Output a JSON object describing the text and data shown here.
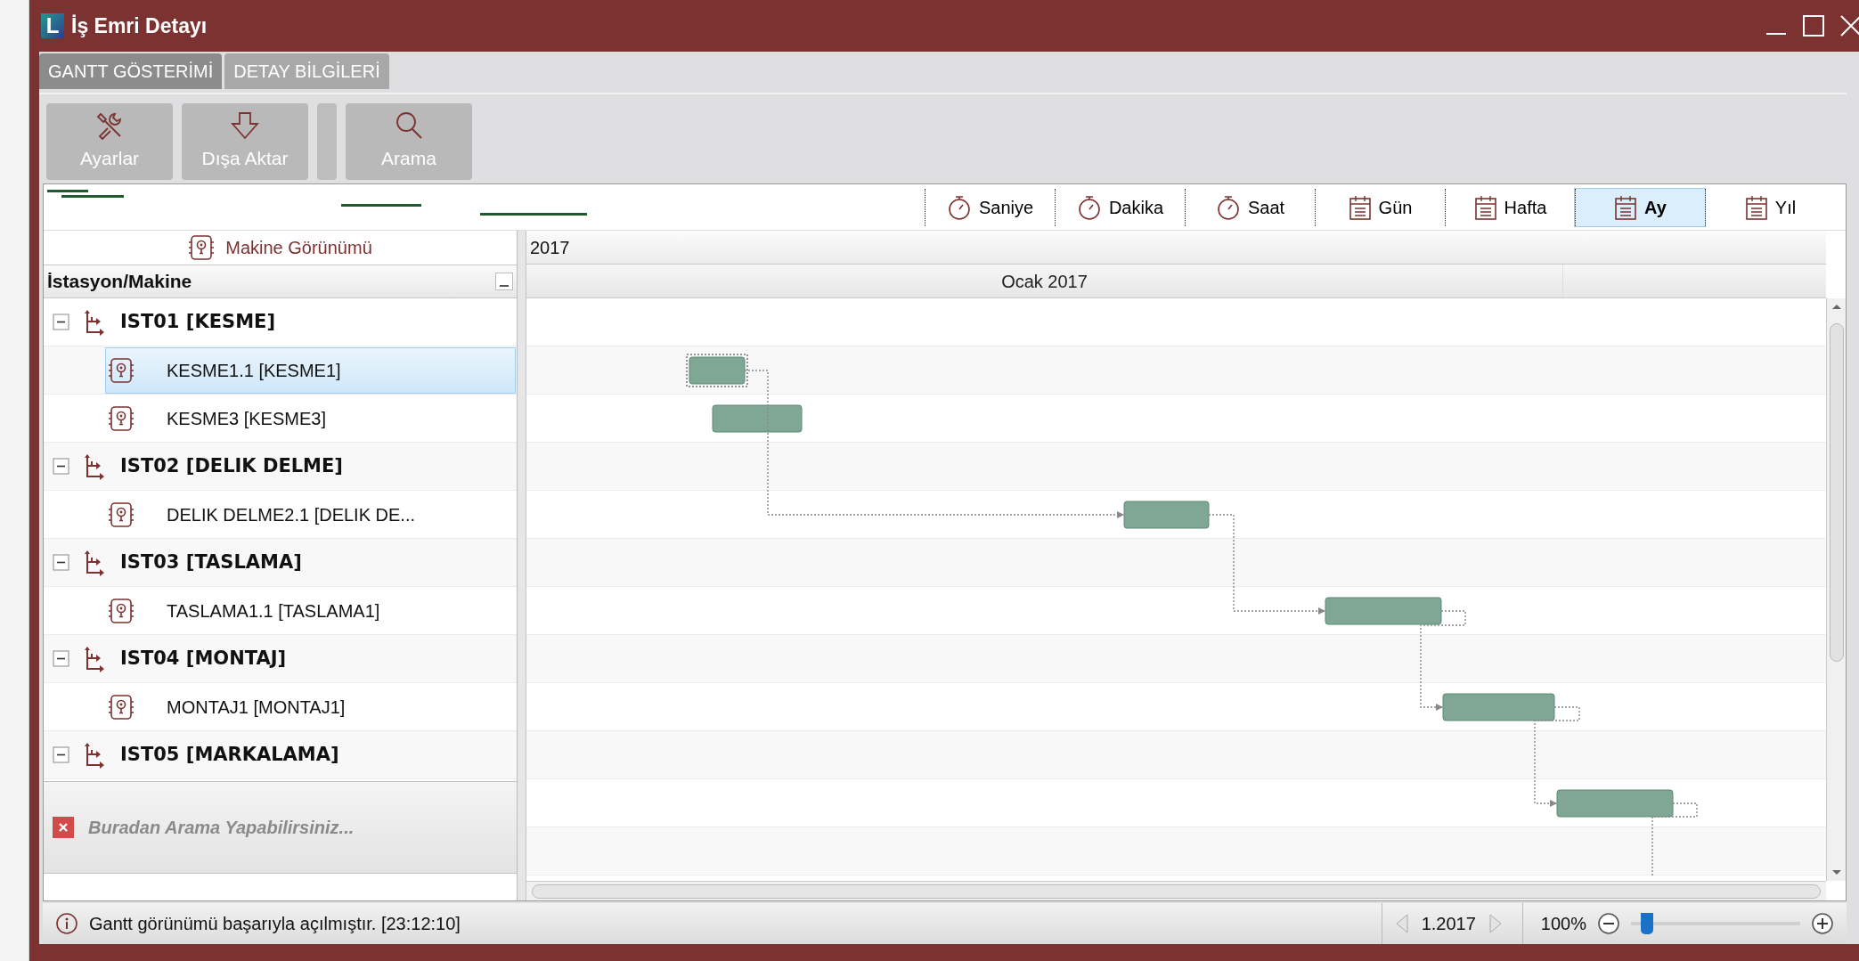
{
  "window": {
    "logo": "L",
    "title": "İş Emri Detayı"
  },
  "tabs": [
    {
      "label": "GANTT GÖSTERİMİ",
      "selected": true
    },
    {
      "label": "DETAY BİLGİLERİ",
      "selected": false
    }
  ],
  "toolbar": [
    {
      "kind": "tools",
      "label": "Ayarlar"
    },
    {
      "kind": "export",
      "label": "Dışa Aktar"
    },
    {
      "kind": "separator"
    },
    {
      "kind": "search",
      "label": "Arama"
    }
  ],
  "time_scales": [
    {
      "kind": "timer",
      "label": "Saniye",
      "selected": false
    },
    {
      "kind": "timer",
      "label": "Dakika",
      "selected": false
    },
    {
      "kind": "timer",
      "label": "Saat",
      "selected": false
    },
    {
      "kind": "calendar",
      "label": "Gün",
      "selected": false
    },
    {
      "kind": "calendar",
      "label": "Hafta",
      "selected": false
    },
    {
      "kind": "calendar",
      "label": "Ay",
      "selected": true
    },
    {
      "kind": "calendar",
      "label": "Yıl",
      "selected": false
    }
  ],
  "tree_panel": {
    "title": "Makine Görünümü",
    "column": "İstasyon/Makine",
    "stations": [
      {
        "label": "IST01 [KESME]",
        "expanded": true,
        "children": [
          {
            "label": "KESME1.1 [KESME1]",
            "selected": true
          },
          {
            "label": "KESME3 [KESME3]",
            "selected": false
          }
        ]
      },
      {
        "label": "IST02 [DELIK DELME]",
        "expanded": true,
        "children": [
          {
            "label": "DELIK DELME2.1 [DELIK DE...",
            "selected": false
          }
        ]
      },
      {
        "label": "IST03 [TASLAMA]",
        "expanded": true,
        "children": [
          {
            "label": "TASLAMA1.1 [TASLAMA1]",
            "selected": false
          }
        ]
      },
      {
        "label": "IST04 [MONTAJ]",
        "expanded": true,
        "children": [
          {
            "label": "MONTAJ1 [MONTAJ1]",
            "selected": false
          }
        ]
      },
      {
        "label": "IST05 [MARKALAMA]",
        "expanded": true
      }
    ],
    "search": {
      "placeholder": "Buradan Arama Yapabilirsiniz..."
    }
  },
  "timeline": {
    "year": "2017",
    "month": "Ocak 2017"
  },
  "status_bar": {
    "message": "Gantt görünümü başarıyla açılmıştır. [23:12:10]",
    "period": "1.2017",
    "zoom": "100%",
    "zoom_slider": {
      "level": 0.06
    }
  }
}
